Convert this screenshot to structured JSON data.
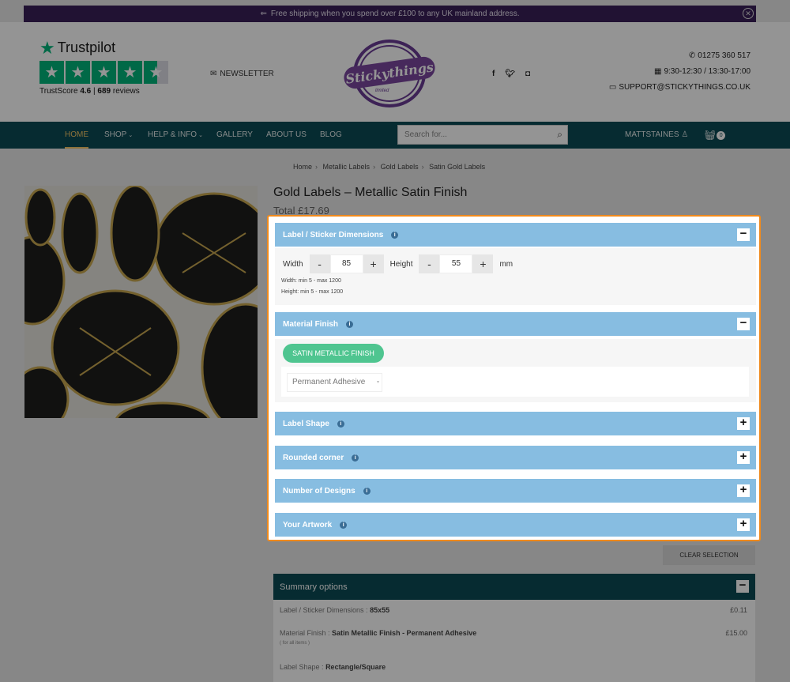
{
  "topbar": {
    "message": "Free shipping when you spend over £100 to any UK mainland address.",
    "close_symbol": "✕"
  },
  "trustpilot": {
    "name": "Trustpilot",
    "trustscore_label": "TrustScore",
    "trustscore": "4.6",
    "separator": "|",
    "reviews_count": "689",
    "reviews_label": "reviews",
    "rating": 4.5
  },
  "header": {
    "newsletter": "NEWSLETTER",
    "logo": {
      "word": "Stickythings",
      "sub": "limited"
    },
    "phone": "01275 360 517",
    "hours": "9:30-12:30 / 13:30-17:00",
    "email": "SUPPORT@STICKYTHINGS.CO.UK",
    "social": [
      "facebook-icon",
      "twitter-icon",
      "instagram-icon"
    ]
  },
  "nav": {
    "items": [
      {
        "label": "HOME",
        "active": true
      },
      {
        "label": "SHOP",
        "dropdown": true
      },
      {
        "label": "HELP & INFO",
        "dropdown": true
      },
      {
        "label": "GALLERY"
      },
      {
        "label": "ABOUT US"
      },
      {
        "label": "BLOG"
      }
    ],
    "search_placeholder": "Search for...",
    "account": "MATTSTAINES",
    "cart_count": "0"
  },
  "breadcrumb": [
    "Home",
    "Metallic Labels",
    "Gold Labels",
    "Satin Gold Labels"
  ],
  "product": {
    "title": "Gold Labels – Metallic Satin Finish",
    "total": "Total £17.69"
  },
  "config": {
    "dimensions": {
      "heading": "Label / Sticker Dimensions",
      "width_label": "Width",
      "width_value": "85",
      "height_label": "Height",
      "height_value": "55",
      "unit": "mm",
      "minus": "-",
      "plus": "+",
      "width_hint": "Width: min 5 - max 1200",
      "height_hint": "Height: min 5 - max 1200"
    },
    "material": {
      "heading": "Material Finish",
      "selected": "SATIN METALLIC FINISH",
      "adhesive": "Permanent Adhesive"
    },
    "collapsed": [
      "Label Shape",
      "Rounded corner",
      "Number of Designs",
      "Your Artwork"
    ],
    "collapse_symbol": "−",
    "expand_symbol": "+",
    "info_symbol": "i"
  },
  "clear_selection": "CLEAR SELECTION",
  "summary": {
    "heading": "Summary options",
    "lines": [
      {
        "label": "Label / Sticker Dimensions :",
        "value": "85x55",
        "price": "£0.11"
      },
      {
        "label": "Material Finish :",
        "value": "Satin Metallic Finish - Permanent Adhesive",
        "price": "£15.00",
        "note": "( for all items )"
      },
      {
        "label": "Label Shape :",
        "value": "Rectangle/Square"
      }
    ]
  },
  "colors": {
    "accent_nav": "#0c4b55",
    "section_head": "#87bde1",
    "selected_pill": "#4fc590",
    "highlight_border": "#f08a1c",
    "trustpilot_green": "#00b67a"
  }
}
